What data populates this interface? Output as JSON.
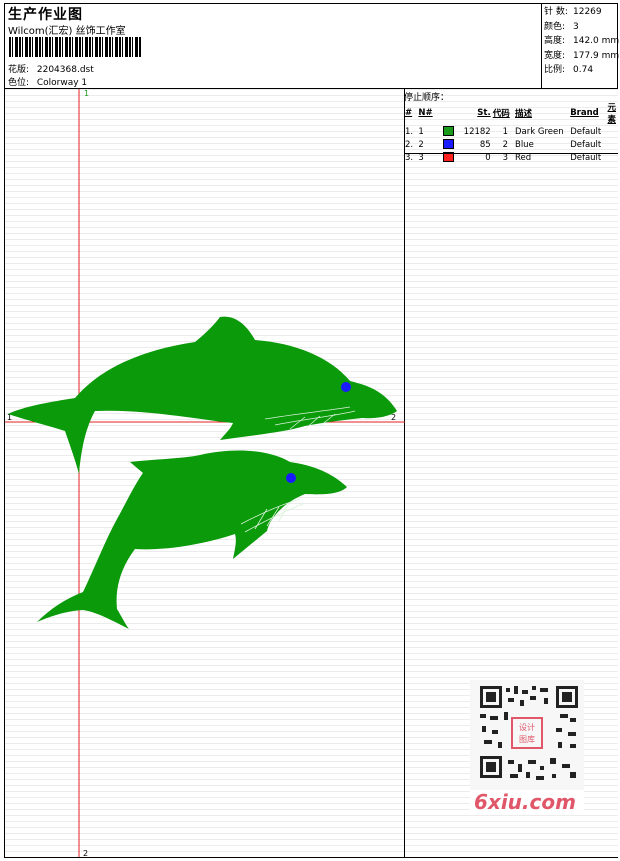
{
  "header": {
    "title": "生产作业图",
    "company": "Wilcom(汇宏) 丝饰工作室",
    "design_label": "花版:",
    "design_value": "2204368.dst",
    "colorway_label": "色位:",
    "colorway_value": "Colorway 1"
  },
  "stats": [
    {
      "label": "针 数:",
      "value": "12269"
    },
    {
      "label": "颜色:",
      "value": "3"
    },
    {
      "label": "高度:",
      "value": "142.0 mm"
    },
    {
      "label": "宽度:",
      "value": "177.9 mm"
    },
    {
      "label": "比例:",
      "value": "0.74"
    }
  ],
  "canvas": {
    "axis_marker_top": "1",
    "axis_marker_bottom": "2",
    "axis_marker_left": "1",
    "axis_marker_right": "2",
    "crosshair_color": "#e02020",
    "dolphin_color": "#0a9a0a",
    "eye_color": "#1a1aff"
  },
  "stop_sequence": {
    "title": "停止顺序：",
    "columns": [
      "#",
      "N#",
      "St.",
      "代码",
      "描述",
      "Brand",
      "元素"
    ],
    "rows": [
      {
        "idx": "1.",
        "n": "1",
        "color": "#1a9a1a",
        "st": "12182",
        "code": "1",
        "desc": "Dark Green",
        "brand": "Default",
        "elem": ""
      },
      {
        "idx": "2.",
        "n": "2",
        "color": "#1a1aff",
        "st": "85",
        "code": "2",
        "desc": "Blue",
        "brand": "Default",
        "elem": ""
      },
      {
        "idx": "3.",
        "n": "3",
        "color": "#ff2020",
        "st": "0",
        "code": "3",
        "desc": "Red",
        "brand": "Default",
        "elem": ""
      }
    ]
  },
  "watermark": {
    "site": "6xiu.com",
    "stamp": "设计图库",
    "color": "#e0576a"
  }
}
